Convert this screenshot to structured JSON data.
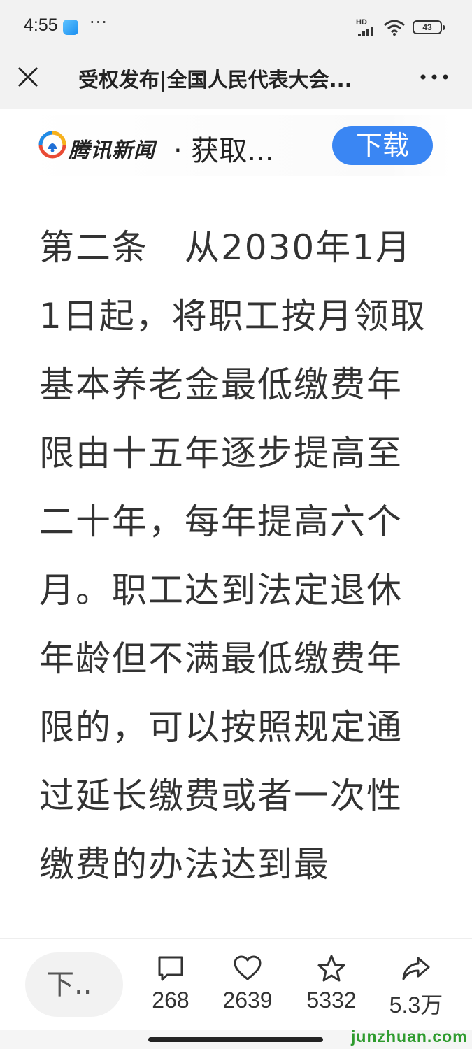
{
  "status_bar": {
    "time": "4:55",
    "dots": "···",
    "network": "HD",
    "battery": "43"
  },
  "nav": {
    "title": "受权发布|全国人民代表大会..."
  },
  "promo": {
    "brand": "腾讯新闻",
    "text": "· 获取...",
    "download_label": "下载",
    "accent_color": "#3a86f3"
  },
  "article": {
    "text": "第二条　从2030年1月1日起，将职工按月领取基本养老金最低缴费年限由十五年逐步提高至二十年，每年提高六个月。职工达到法定退休年龄但不满最低缴费年限的，可以按照规定通过延长缴费或者一次性缴费的办法达到最"
  },
  "actions": {
    "input_placeholder": "下..",
    "comments": "268",
    "likes": "2639",
    "favorites": "5332",
    "shares": "5.3万"
  },
  "watermark": "junzhuan.com"
}
